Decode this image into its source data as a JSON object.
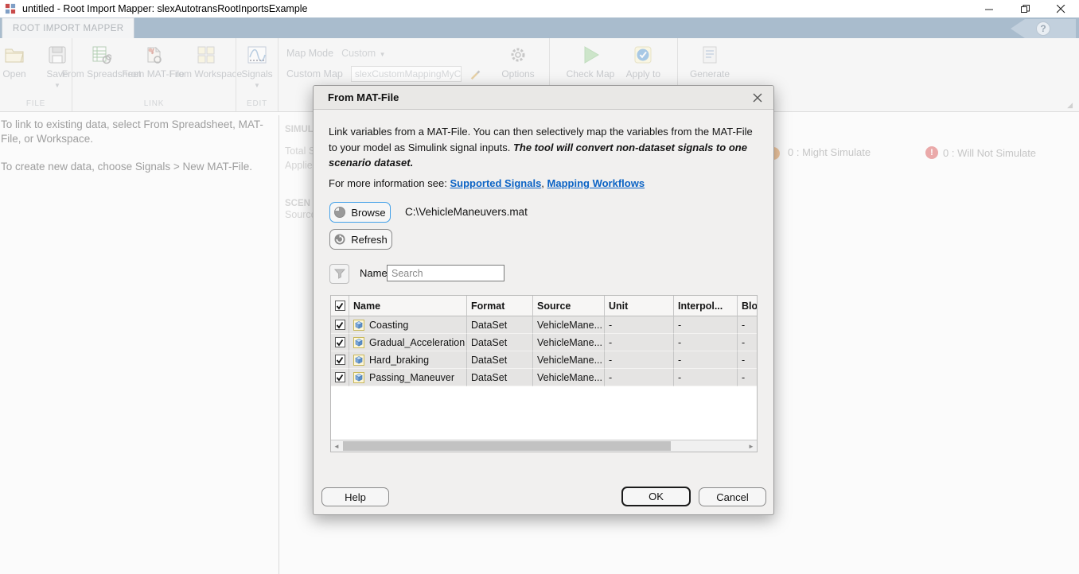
{
  "window": {
    "title": "untitled - Root Import Mapper: slexAutotransRootInportsExample"
  },
  "ribbon": {
    "tab": "ROOT IMPORT MAPPER",
    "file_group": {
      "label": "FILE",
      "open": "Open",
      "save": "Save"
    },
    "link_group": {
      "label": "LINK",
      "from_spreadsheet": "From Spreadsheet",
      "from_mat_file": "From MAT-File",
      "from_workspace": "From Workspace"
    },
    "edit_group": {
      "label": "EDIT",
      "signals": "Signals"
    },
    "mode_group": {
      "map_mode_label": "Map Mode",
      "map_mode_value": "Custom",
      "custom_map_label": "Custom Map",
      "custom_map_value": "slexCustomMappingMyCu"
    },
    "actions": {
      "options": "Options",
      "check_map": "Check Map",
      "apply_to": "Apply to",
      "generate": "Generate"
    }
  },
  "left_panel": {
    "hint1": "To link to existing data, select From Spreadsheet, MAT-File, or Workspace.",
    "hint2": "To create new data, choose Signals > New MAT-File."
  },
  "center_panel": {
    "frag_simulate": "SIMUL",
    "frag_total": "Total S",
    "frag_applied": "Applie",
    "frag_scenario": "SCEN",
    "frag_source": "Source"
  },
  "status": {
    "might_simulate": "0 : Might Simulate",
    "will_not_simulate": "0 : Will Not Simulate",
    "warn_badge": "!"
  },
  "dialog": {
    "title": "From MAT-File",
    "description_normal": "Link variables from a MAT-File. You can then selectively map the variables from the MAT-File to your model as Simulink signal inputs. ",
    "description_emphasis": "The tool will convert non-dataset signals to one scenario dataset.",
    "info_prefix": "For more information see: ",
    "link_supported_signals": "Supported Signals",
    "link_separator": ", ",
    "link_mapping_workflows": "Mapping Workflows",
    "browse_label": "Browse",
    "file_path": "C:\\VehicleManeuvers.mat",
    "refresh_label": "Refresh",
    "filter_label": "Name",
    "search_placeholder": "Search",
    "table": {
      "headers": [
        "Name",
        "Format",
        "Source",
        "Unit",
        "Interpol...",
        "Bloc"
      ],
      "rows": [
        {
          "checked": true,
          "name": "Coasting",
          "format": "DataSet",
          "source": "VehicleMane...",
          "unit": "-",
          "interpolation": "-",
          "block": "-"
        },
        {
          "checked": true,
          "name": "Gradual_Acceleration",
          "format": "DataSet",
          "source": "VehicleMane...",
          "unit": "-",
          "interpolation": "-",
          "block": "-"
        },
        {
          "checked": true,
          "name": "Hard_braking",
          "format": "DataSet",
          "source": "VehicleMane...",
          "unit": "-",
          "interpolation": "-",
          "block": "-"
        },
        {
          "checked": true,
          "name": "Passing_Maneuver",
          "format": "DataSet",
          "source": "VehicleMane...",
          "unit": "-",
          "interpolation": "-",
          "block": "-"
        }
      ]
    },
    "help_label": "Help",
    "ok_label": "OK",
    "cancel_label": "Cancel"
  },
  "colors": {
    "tabstrip": "#a9bccd",
    "accent_focus": "#42a0e8",
    "link": "#0b63c5",
    "dialog_bg": "#f1f0ef",
    "row_bg": "#e5e4e3",
    "status_error_badge": "#eaa9a9",
    "disabled_text": "#c9cbce"
  }
}
